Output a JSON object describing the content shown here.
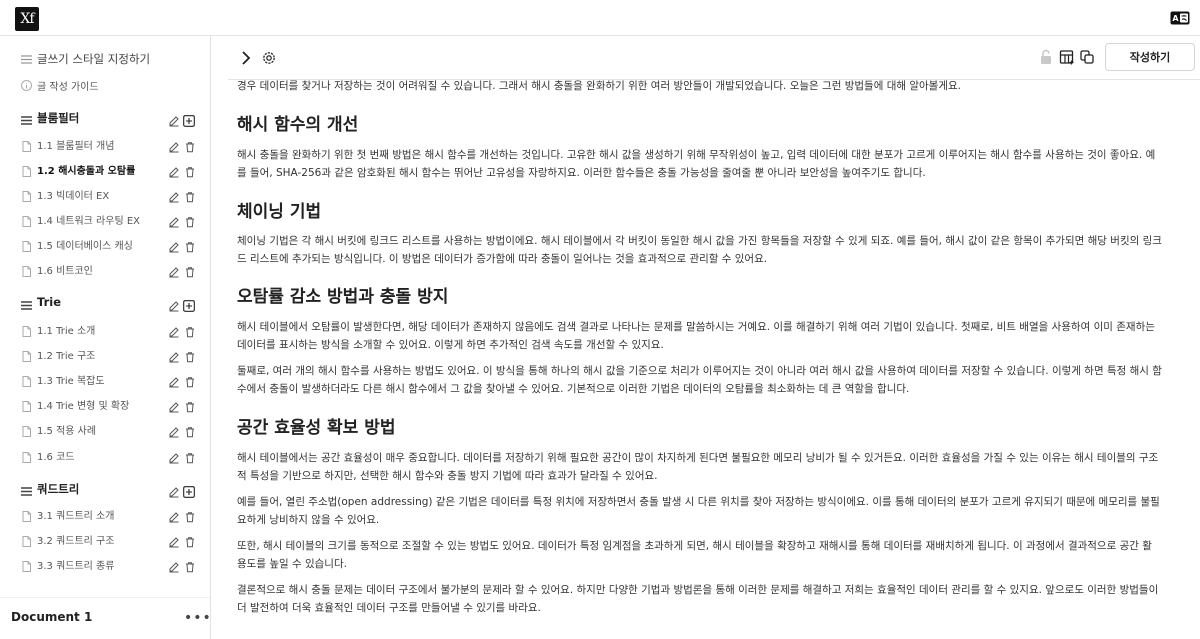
{
  "app": {
    "logo_text": "Xf"
  },
  "sidebar": {
    "top_items": [
      {
        "label": "글쓰기 스타일 지정하기"
      },
      {
        "label": "글 작성 가이드"
      }
    ],
    "groups": [
      {
        "title": "블룸필터",
        "items": [
          "1.1 블룸필터 개념",
          "1.2 해시충돌과 오탐률",
          "1.3 빅데이터 EX",
          "1.4 네트워크 라우팅 EX",
          "1.5 데이터베이스 캐싱",
          "1.6 비트코인"
        ]
      },
      {
        "title": "Trie",
        "items": [
          "1.1 Trie 소개",
          "1.2 Trie 구조",
          "1.3 Trie 복잡도",
          "1.4 Trie 변형 및 확장",
          "1.5 적용 사례",
          "1.6 코드"
        ]
      },
      {
        "title": "쿼드트리",
        "items": [
          "3.1 쿼드트리 소개",
          "3.2 쿼드트리 구조",
          "3.3 쿼드트리 종류"
        ]
      }
    ],
    "active_item": "1.2 해시충돌과 오탐률",
    "document_name": "Document 1",
    "more_label": "•••"
  },
  "toolbar": {
    "publish_label": "작성하기"
  },
  "content": {
    "intro": "경우 데이터를 찾거나 저장하는 것이 어려워질 수 있습니다. 그래서 해시 충돌을 완화하기 위한 여러 방안들이 개발되었습니다. 오늘은 그런 방법들에 대해 알아볼게요.",
    "sections": [
      {
        "heading": "해시 함수의 개선",
        "paragraphs": [
          [
            "해시 충돌을 완화하기 위한 첫 번째 방법은 해시 함수를 개선하는 것입니다. 고유한 해시 값을 생성하기 위해 무작위성이 높고, 입력 데이터에 대한 분포가 고르게 이루어지는 해시 함수를 사용하는 것이 좋아요. 예",
            "를 들어, SHA-256과 같은 암호화된 해시 함수는 뛰어난 고유성을 자랑하지요. 이러한 함수들은 충돌 가능성을 줄여줄 뿐 아니라 보안성을 높여주기도 합니다."
          ]
        ]
      },
      {
        "heading": "체이닝 기법",
        "paragraphs": [
          [
            "체이닝 기법은 각 해시 버킷에 링크드 리스트를 사용하는 방법이에요. 해시 테이블에서 각 버킷이 동일한 해시 값을 가진 항목들을 저장할 수 있게 되죠. 예를 들어, 해시 값이 같은 항목이 추가되면 해당 버킷의 링크",
            "드 리스트에 추가되는 방식입니다. 이 방법은 데이터가 증가함에 따라 충돌이 일어나는 것을 효과적으로 관리할 수 있어요."
          ]
        ]
      },
      {
        "heading": "오탐률 감소 방법과 충돌 방지",
        "paragraphs": [
          [
            "해시 테이블에서 오탐률이 발생한다면, 해당 데이터가 존재하지 않음에도 검색 결과로 나타나는 문제를 말씀하시는 거예요. 이를 해결하기 위해 여러 기법이 있습니다. 첫째로, 비트 배열을 사용하여 이미 존재하는",
            "데이터를 표시하는 방식을 소개할 수 있어요. 이렇게 하면 추가적인 검색 속도를 개선할 수 있지요."
          ],
          [
            "둘째로, 여러 개의 해시 함수를 사용하는 방법도 있어요. 이 방식을 통해 하나의 해시 값을 기준으로 처리가 이루어지는 것이 아니라 여러 해시 값을 사용하여 데이터를 저장할 수 있습니다. 이렇게 하면 특정 해시 함",
            "수에서 충돌이 발생하더라도 다른 해시 함수에서 그 값을 찾아낼 수 있어요. 기본적으로 이러한 기법은 데이터의 오탐률을 최소화하는 데 큰 역할을 합니다."
          ]
        ]
      },
      {
        "heading": "공간 효율성 확보 방법",
        "paragraphs": [
          [
            "해시 테이블에서는 공간 효율성이 매우 중요합니다. 데이터를 저장하기 위해 필요한 공간이 많이 차지하게 된다면 불필요한 메모리 낭비가 될 수 있거든요. 이러한 효율성을 가질 수 있는 이유는 해시 테이블의 구조",
            "적 특성을 기반으로 하지만, 선택한 해시 함수와 충돌 방지 기법에 따라 효과가 달라질 수 있어요."
          ],
          [
            "예를 들어, 열린 주소법(open addressing) 같은 기법은 데이터를 특정 위치에 저장하면서 충돌 발생 시 다른 위치를 찾아 저장하는 방식이에요. 이를 통해 데이터의 분포가 고르게 유지되기 때문에 메모리를 불필",
            "요하게 낭비하지 않을 수 있어요."
          ],
          [
            "또한, 해시 테이블의 크기를 동적으로 조절할 수 있는 방법도 있어요. 데이터가 특정 임계점을 초과하게 되면, 해시 테이블을 확장하고 재해시를 통해 데이터를 재배치하게 됩니다. 이 과정에서 결과적으로 공간 활",
            "용도를 높일 수 있습니다."
          ],
          [
            "결론적으로 해시 충돌 문제는 데이터 구조에서 불가분의 문제라 할 수 있어요. 하지만 다양한 기법과 방법론을 통해 이러한 문제를 해결하고 저희는 효율적인 데이터 관리를 할 수 있지요. 앞으로도 이러한 방법들이",
            "더 발전하여 더욱 효율적인 데이터 구조를 만들어낼 수 있기를 바라요."
          ]
        ]
      }
    ]
  }
}
